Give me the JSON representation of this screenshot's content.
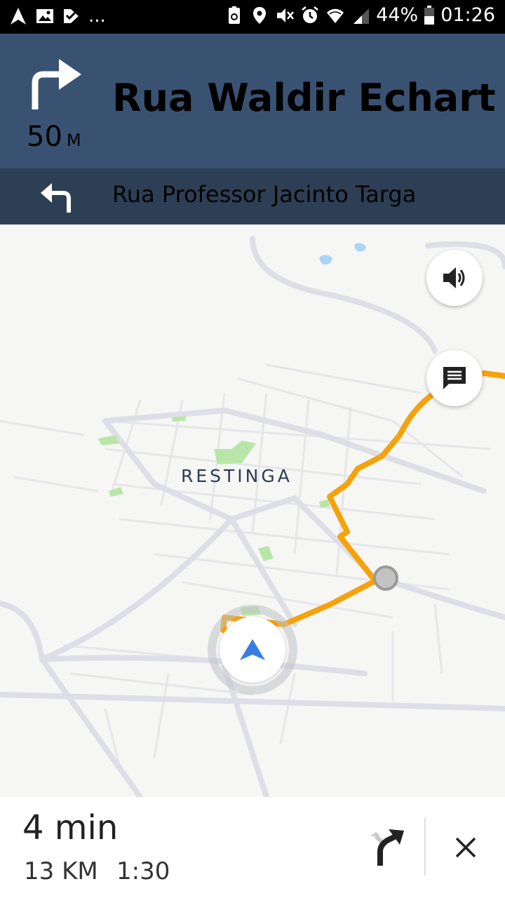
{
  "status_bar": {
    "left_icons": [
      "navigation-icon",
      "gallery-icon",
      "tasks-icon"
    ],
    "more": "...",
    "right_icons": [
      "battery-saver-icon",
      "location-icon",
      "mute-icon",
      "alarm-icon",
      "wifi-icon",
      "signal-icon"
    ],
    "battery_percent": "44%",
    "time": "01:26"
  },
  "navigation": {
    "current_maneuver": "turn-right",
    "distance_value": "50",
    "distance_unit": "M",
    "current_street": "Rua Waldir Echart",
    "next_maneuver": "turn-left",
    "next_street": "Rua Professor Jacinto Targa"
  },
  "map": {
    "area_label": "RESTINGA",
    "route_color": "#f5a20b",
    "controls": [
      "volume-icon",
      "report-icon"
    ]
  },
  "trip": {
    "eta": "4 min",
    "remaining_distance": "13 KM",
    "arrival_time": "1:30"
  },
  "colors": {
    "nav_primary": "#3a5272",
    "nav_secondary": "#2d3f55",
    "position_marker": "#3a7de0"
  }
}
